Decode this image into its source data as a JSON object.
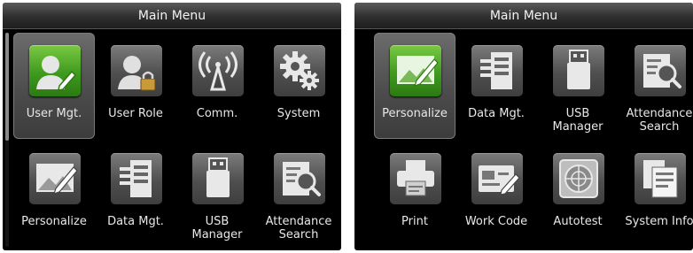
{
  "left_screen": {
    "title": "Main Menu",
    "items": [
      {
        "label": "User Mgt.",
        "selected": true
      },
      {
        "label": "User Role"
      },
      {
        "label": "Comm."
      },
      {
        "label": "System"
      },
      {
        "label": "Personalize"
      },
      {
        "label": "Data Mgt."
      },
      {
        "label": "USB",
        "label2": "Manager"
      },
      {
        "label": "Attendance",
        "label2": "Search"
      }
    ]
  },
  "right_screen": {
    "title": "Main Menu",
    "items": [
      {
        "label": "Personalize",
        "selected": true
      },
      {
        "label": "Data Mgt."
      },
      {
        "label": "USB",
        "label2": "Manager"
      },
      {
        "label": "Attendance",
        "label2": "Search"
      },
      {
        "label": "Print"
      },
      {
        "label": "Work Code"
      },
      {
        "label": "Autotest"
      },
      {
        "label": "System Info"
      }
    ]
  },
  "colors": {
    "background": "#000000",
    "selected_tile": "#5a5a5a",
    "icon_gray": "#5a5a5a",
    "icon_green": "#3f9a1f",
    "text": "#e8e8e8"
  }
}
